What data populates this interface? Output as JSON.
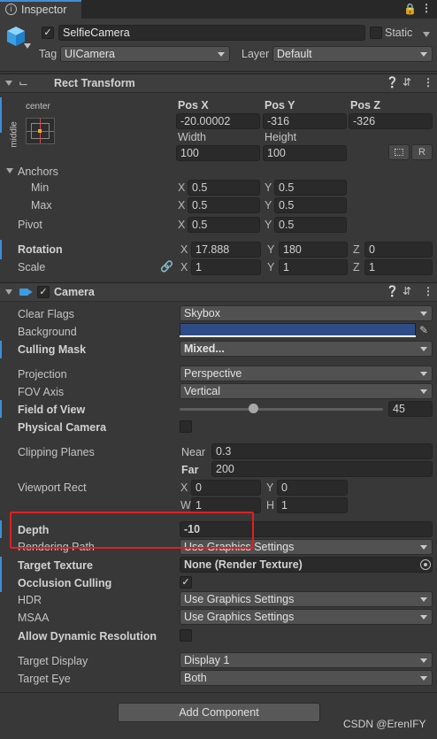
{
  "tab": {
    "label": "Inspector"
  },
  "gameobject": {
    "name": "SelfieCamera",
    "static_label": "Static",
    "tag_label": "Tag",
    "tag_value": "UICamera",
    "layer_label": "Layer",
    "layer_value": "Default"
  },
  "rect_transform": {
    "title": "Rect Transform",
    "anchor_h": "center",
    "anchor_v": "middle",
    "pos_x_label": "Pos X",
    "pos_x": "-20.00002",
    "pos_y_label": "Pos Y",
    "pos_y": "-316",
    "pos_z_label": "Pos Z",
    "pos_z": "-326",
    "width_label": "Width",
    "width": "100",
    "height_label": "Height",
    "height": "100",
    "r_label": "R",
    "anchors_label": "Anchors",
    "min_label": "Min",
    "min_x": "0.5",
    "min_y": "0.5",
    "max_label": "Max",
    "max_x": "0.5",
    "max_y": "0.5",
    "pivot_label": "Pivot",
    "pivot_x": "0.5",
    "pivot_y": "0.5",
    "rotation_label": "Rotation",
    "rot_x": "17.888",
    "rot_y": "180",
    "rot_z": "0",
    "scale_label": "Scale",
    "scale_x": "1",
    "scale_y": "1",
    "scale_z": "1",
    "x": "X",
    "y": "Y",
    "z": "Z"
  },
  "camera": {
    "title": "Camera",
    "clear_flags_label": "Clear Flags",
    "clear_flags": "Skybox",
    "background_label": "Background",
    "background_color": "#2e4d86",
    "culling_mask_label": "Culling Mask",
    "culling_mask": "Mixed...",
    "projection_label": "Projection",
    "projection": "Perspective",
    "fov_axis_label": "FOV Axis",
    "fov_axis": "Vertical",
    "fov_label": "Field of View",
    "fov": "45",
    "fov_fraction": 0.36,
    "physical_label": "Physical Camera",
    "clipping_label": "Clipping Planes",
    "near_label": "Near",
    "near": "0.3",
    "far_label": "Far",
    "far": "200",
    "viewport_label": "Viewport Rect",
    "vx_label": "X",
    "vx": "0",
    "vy_label": "Y",
    "vy": "0",
    "vw_label": "W",
    "vw": "1",
    "vh_label": "H",
    "vh": "1",
    "depth_label": "Depth",
    "depth": "-10",
    "rendering_path_label": "Rendering Path",
    "rendering_path": "Use Graphics Settings",
    "target_texture_label": "Target Texture",
    "target_texture": "None (Render Texture)",
    "occlusion_label": "Occlusion Culling",
    "hdr_label": "HDR",
    "hdr": "Use Graphics Settings",
    "msaa_label": "MSAA",
    "msaa": "Use Graphics Settings",
    "dynres_label": "Allow Dynamic Resolution",
    "target_display_label": "Target Display",
    "target_display": "Display 1",
    "target_eye_label": "Target Eye",
    "target_eye": "Both"
  },
  "add_component": "Add Component",
  "watermark": "CSDN @ErenIFY",
  "colors": {
    "highlight_box": "#e02020",
    "accent": "#3d8fd8"
  }
}
